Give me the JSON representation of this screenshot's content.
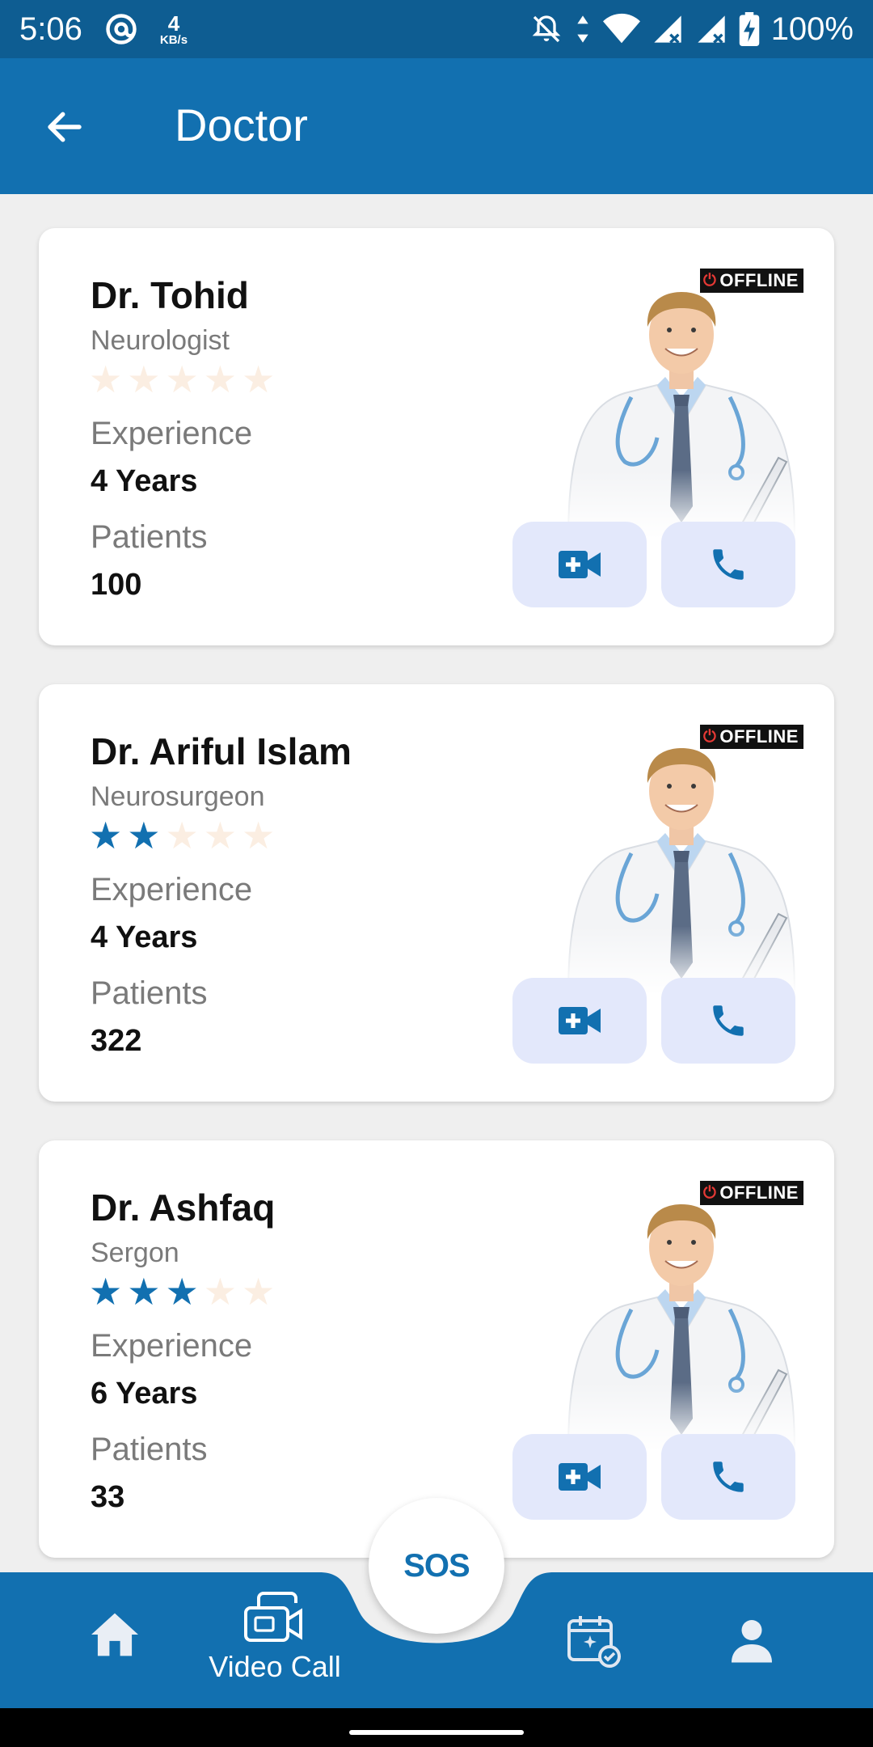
{
  "status_bar": {
    "time": "5:06",
    "net_speed_value": "4",
    "net_speed_unit": "KB/s",
    "battery": "100%"
  },
  "header": {
    "title": "Doctor"
  },
  "doctors": [
    {
      "name": "Dr. Tohid",
      "specialty": "Neurologist",
      "rating": 0,
      "experience_label": "Experience",
      "experience_value": "4 Years",
      "patients_label": "Patients",
      "patients_value": "100",
      "status": "OFFLINE"
    },
    {
      "name": "Dr. Ariful Islam",
      "specialty": "Neurosurgeon",
      "rating": 2,
      "experience_label": "Experience",
      "experience_value": "4 Years",
      "patients_label": "Patients",
      "patients_value": "322",
      "status": "OFFLINE"
    },
    {
      "name": "Dr. Ashfaq",
      "specialty": "Sergon",
      "rating": 3,
      "experience_label": "Experience",
      "experience_value": "6 Years",
      "patients_label": "Patients",
      "patients_value": "33",
      "status": "OFFLINE"
    }
  ],
  "bottom_nav": {
    "video_call_label": "Video Call",
    "sos_label": "SOS"
  },
  "colors": {
    "primary": "#1270b0",
    "status_bar": "#0e5d92",
    "star_on": "#1270b0",
    "star_off": "#fbeee2",
    "button_bg": "#e3e8fb"
  }
}
